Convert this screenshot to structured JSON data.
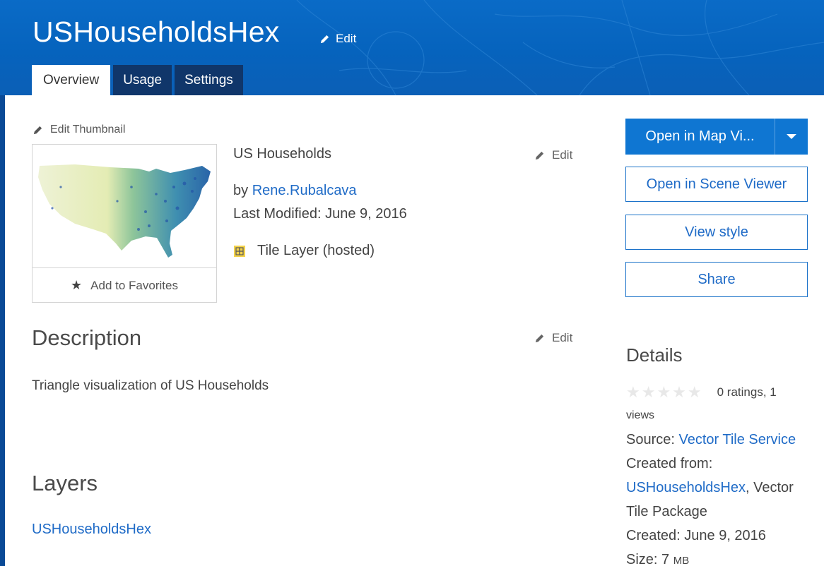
{
  "header": {
    "title": "USHouseholdsHex",
    "edit_label": "Edit",
    "tabs": [
      {
        "label": "Overview",
        "active": true
      },
      {
        "label": "Usage",
        "active": false
      },
      {
        "label": "Settings",
        "active": false
      }
    ]
  },
  "thumbnail": {
    "edit_label": "Edit Thumbnail",
    "favorites_label": "Add to Favorites"
  },
  "summary": {
    "title": "US Households",
    "edit_label": "Edit",
    "by_prefix": "by ",
    "owner": "Rene.Rubalcava",
    "last_modified": "Last Modified: June 9, 2016",
    "item_type": "Tile Layer (hosted)"
  },
  "description": {
    "heading": "Description",
    "edit_label": "Edit",
    "text": "Triangle visualization of US Households"
  },
  "layers": {
    "heading": "Layers",
    "items": [
      "USHouseholdsHex"
    ]
  },
  "actions": {
    "open_map_viewer": "Open in Map Vi...",
    "open_scene_viewer": "Open in Scene Viewer",
    "view_style": "View style",
    "share": "Share"
  },
  "details": {
    "heading": "Details",
    "rating_stars": 0,
    "ratings_text": "0 ratings, 1",
    "views_text": "views",
    "source_label": "Source: ",
    "source_link": "Vector Tile Service",
    "created_from_label": "Created from:",
    "created_from_link": "USHouseholdsHex",
    "created_from_suffix": ", Vector",
    "created_from_suffix2": "Tile Package",
    "created": "Created: June 9, 2016",
    "size_label": "Size: 7 ",
    "size_unit": "MB"
  },
  "colors": {
    "brand_blue": "#0f76d2",
    "link_blue": "#1f6bc7",
    "tab_dark": "#10366a"
  }
}
